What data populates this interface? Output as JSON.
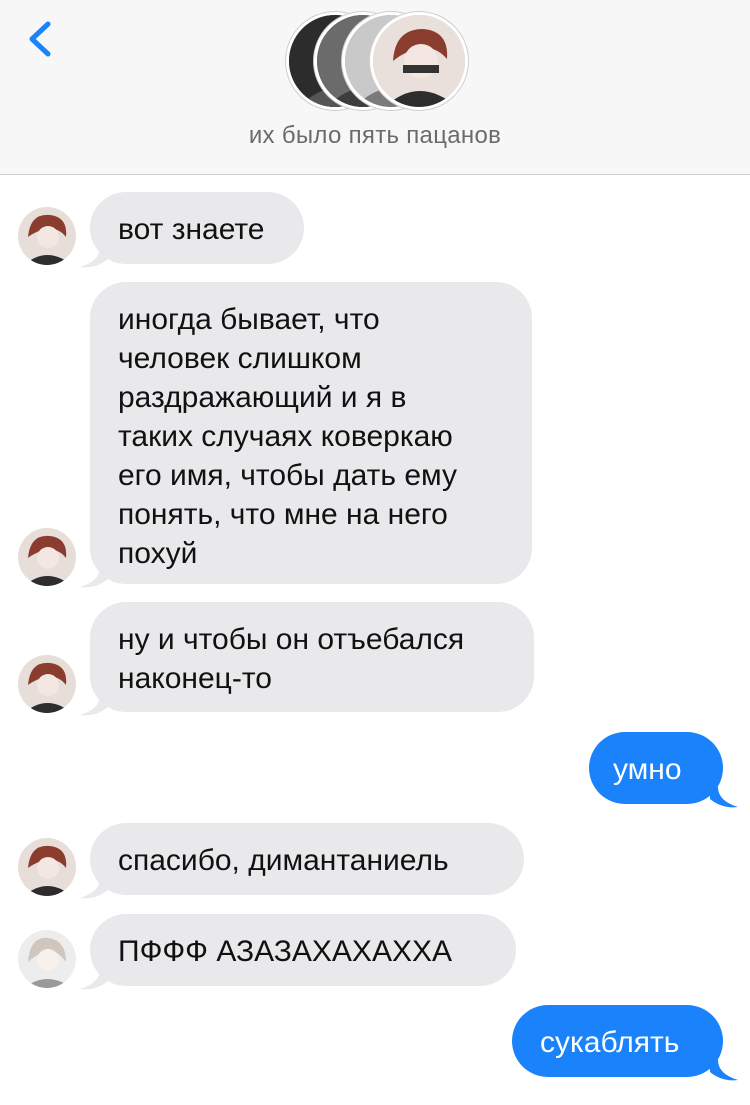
{
  "header": {
    "back_icon": "chevron-left-icon",
    "title": "их было пять пацанов",
    "group_avatar_count": 4
  },
  "colors": {
    "accent": "#1a82fb",
    "incoming_bubble": "#e9e9eb",
    "outgoing_bubble": "#1a82fb",
    "header_bg": "#f7f7f7"
  },
  "messages": [
    {
      "direction": "incoming",
      "sender_avatar": "red-hair-avatar",
      "lines": [
        "вот знаете"
      ]
    },
    {
      "direction": "incoming",
      "sender_avatar": "red-hair-avatar",
      "lines": [
        "иногда бывает, что",
        "человек слишком",
        "раздражающий и я в",
        "таких случаях коверкаю",
        "его имя, чтобы дать ему",
        "понять, что мне на него",
        "похуй"
      ]
    },
    {
      "direction": "incoming",
      "sender_avatar": "red-hair-avatar",
      "lines": [
        "ну и чтобы он отъебался",
        "наконец-то"
      ]
    },
    {
      "direction": "outgoing",
      "lines": [
        "умно"
      ]
    },
    {
      "direction": "incoming",
      "sender_avatar": "red-hair-avatar",
      "lines": [
        "спасибо, димантаниель"
      ]
    },
    {
      "direction": "incoming",
      "sender_avatar": "light-hair-avatar",
      "lines": [
        "ПФФФ АЗАЗАХАХАХХА"
      ]
    },
    {
      "direction": "outgoing",
      "lines": [
        "сукаблять"
      ]
    }
  ]
}
